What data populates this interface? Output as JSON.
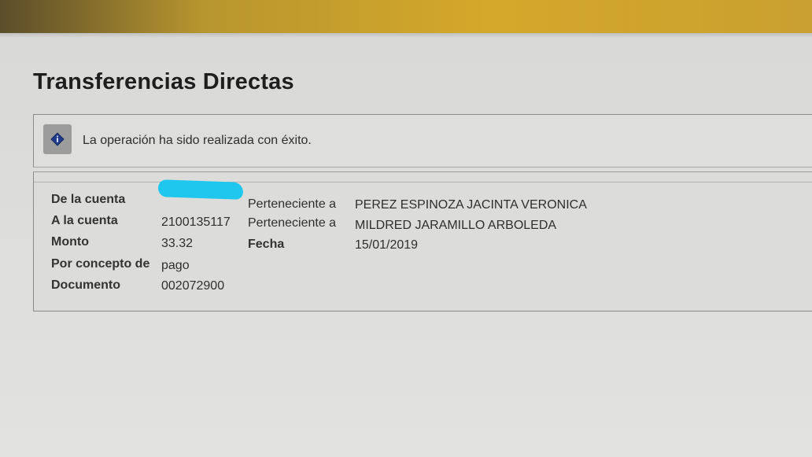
{
  "header": {
    "title": "Transferencias Directas"
  },
  "notice": {
    "icon": "info-diamond-icon",
    "message": "La operación ha sido realizada con éxito."
  },
  "details": {
    "from_account_label": "De la cuenta",
    "from_account_owner_prefix": "Perteneciente a",
    "from_account_owner": "PEREZ ESPINOZA JACINTA VERONICA",
    "to_account_label": "A la cuenta",
    "to_account_number": "2100135117",
    "to_account_owner_prefix": "Perteneciente a",
    "to_account_owner": "MILDRED JARAMILLO ARBOLEDA",
    "amount_label": "Monto",
    "amount_value": "33.32",
    "date_label": "Fecha",
    "date_value": "15/01/2019",
    "concept_label": "Por concepto de",
    "concept_value": "pago",
    "document_label": "Documento",
    "document_value": "002072900"
  },
  "colors": {
    "top_bar": "#d4a82a",
    "redaction": "#1fc7ee",
    "icon_diamond": "#1f3a8a"
  }
}
